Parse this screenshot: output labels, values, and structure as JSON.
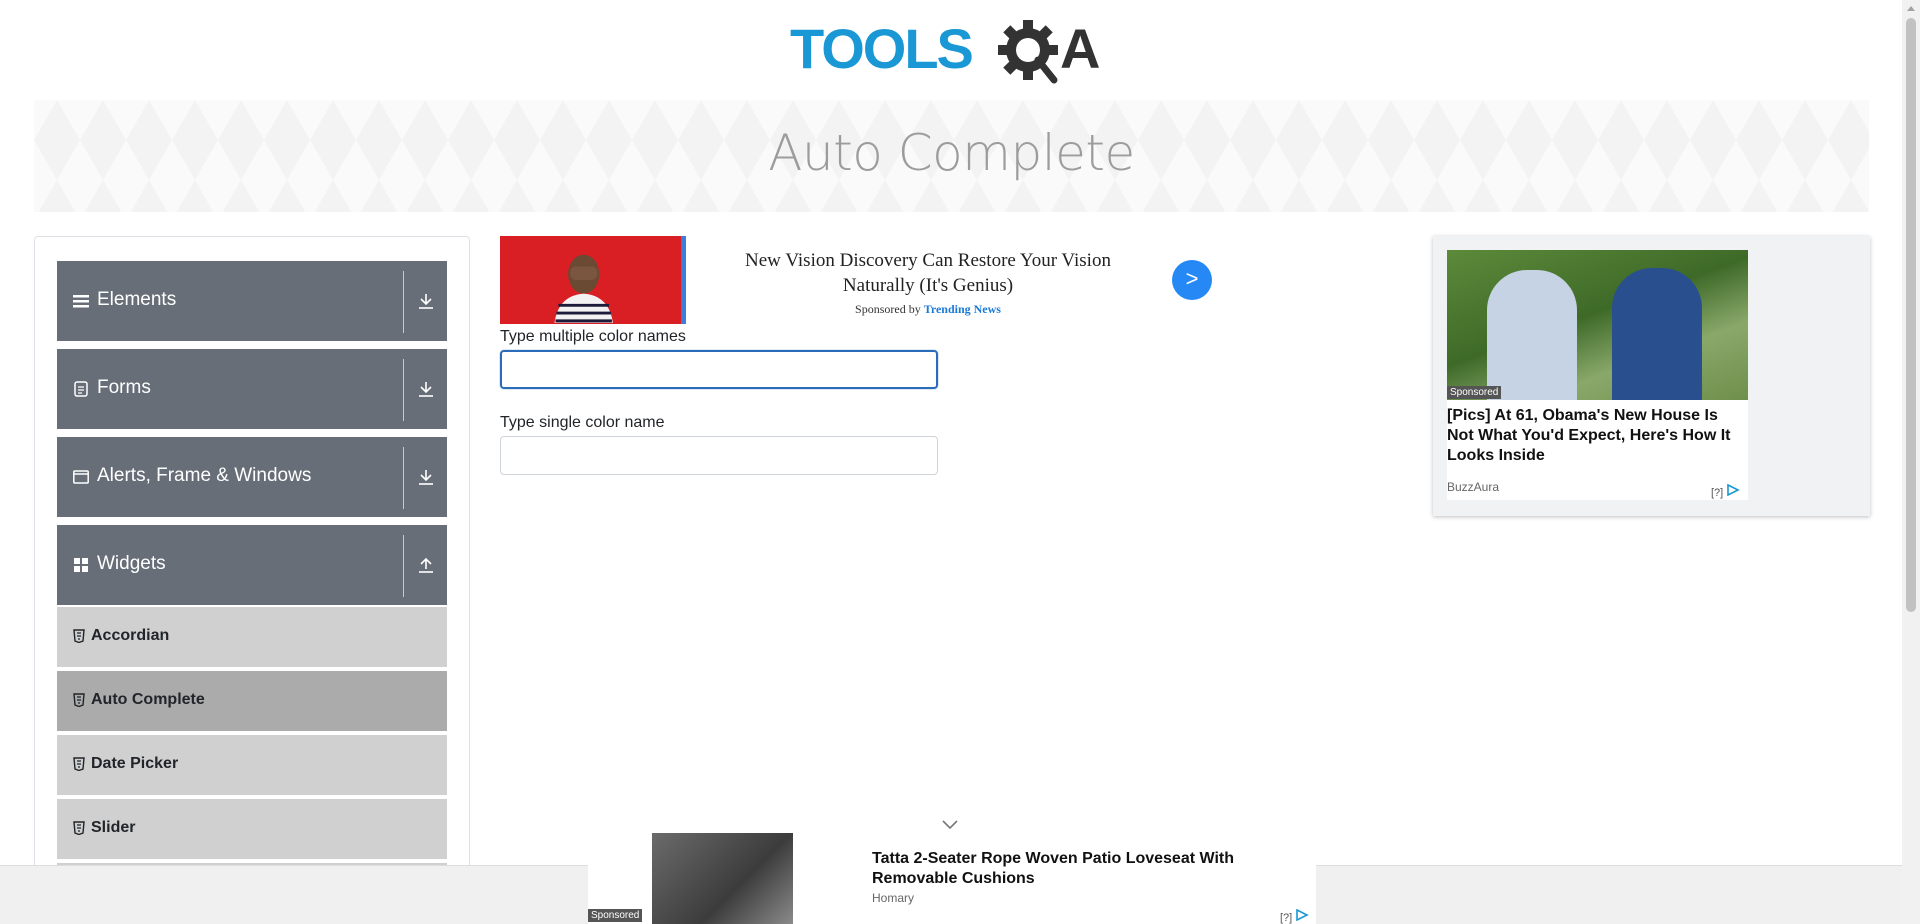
{
  "header": {
    "logo_text": "TOOLSQA"
  },
  "banner": {
    "title": "Auto Complete"
  },
  "sidebar": {
    "groups": [
      {
        "label": "Elements",
        "icon": "hamburger-icon",
        "toggle": "download-arrow-icon"
      },
      {
        "label": "Forms",
        "icon": "document-icon",
        "toggle": "download-arrow-icon"
      },
      {
        "label": "Alerts, Frame & Windows",
        "icon": "window-icon",
        "toggle": "download-arrow-icon"
      },
      {
        "label": "Widgets",
        "icon": "grid-icon",
        "toggle": "upload-arrow-icon"
      }
    ],
    "items": [
      {
        "label": "Accordian",
        "active": false
      },
      {
        "label": "Auto Complete",
        "active": true
      },
      {
        "label": "Date Picker",
        "active": false
      },
      {
        "label": "Slider",
        "active": false
      }
    ]
  },
  "top_ad": {
    "headline": "New Vision Discovery Can Restore Your Vision Naturally (It's Genius)",
    "sponsored_prefix": "Sponsored by",
    "sponsor": "Trending News",
    "go_label": ">"
  },
  "form": {
    "multi_label": "Type multiple color names",
    "multi_value": "",
    "single_label": "Type single color name",
    "single_value": ""
  },
  "right_ad": {
    "badge": "Sponsored",
    "headline": "[Pics] At 61, Obama's New House Is Not What You'd Expect, Here's How It Looks Inside",
    "source": "BuzzAura",
    "adchoice": "[?]"
  },
  "bottom_ad": {
    "badge": "Sponsored",
    "headline": "Tatta 2-Seater Rope Woven Patio Loveseat With Removable Cushions",
    "source": "Homary",
    "adchoice": "[?]"
  },
  "colors": {
    "logo_blue": "#1a97d5",
    "logo_dark": "#333333",
    "group_bg": "#676e78",
    "item_bg": "#d0d0d0",
    "item_active_bg": "#ababab",
    "focus_border": "#2a6cb8",
    "ad_go": "#2588f5"
  }
}
